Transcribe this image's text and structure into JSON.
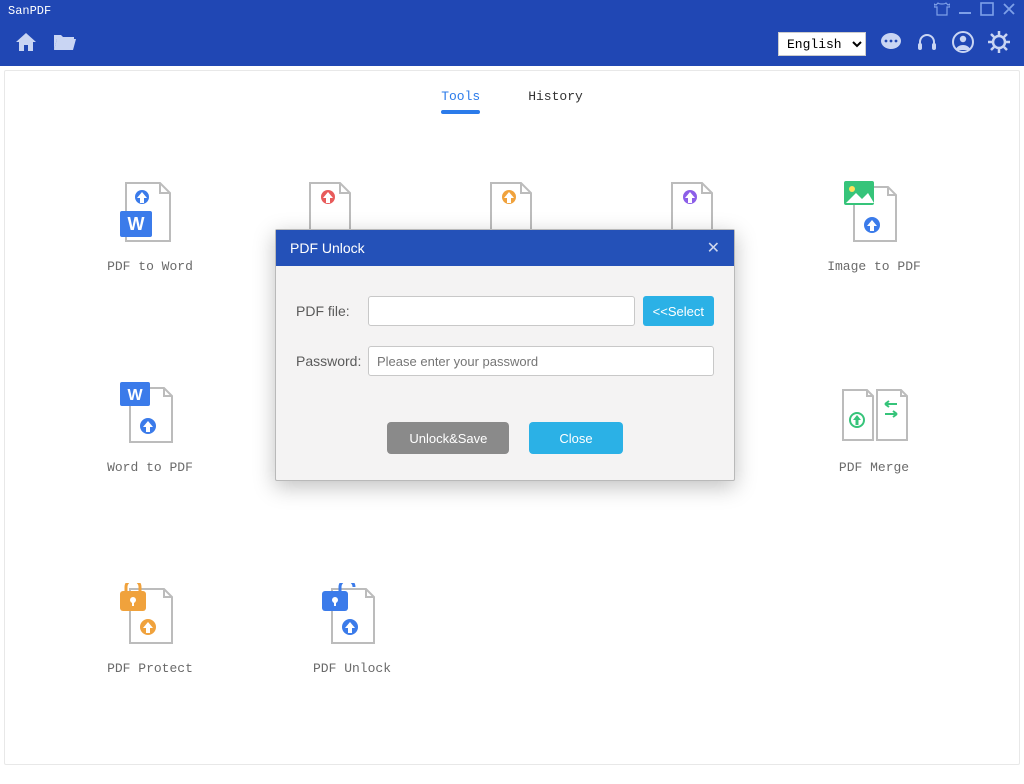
{
  "app": {
    "title": "SanPDF"
  },
  "toolbar": {
    "language": "English"
  },
  "tabs": {
    "tools": "Tools",
    "history": "History"
  },
  "tools": {
    "pdf_to_word": "PDF to Word",
    "image_to_pdf": "Image to PDF",
    "word_to_pdf": "Word to PDF",
    "pdf_merge": "PDF Merge",
    "pdf_protect": "PDF Protect",
    "pdf_unlock": "PDF Unlock"
  },
  "dialog": {
    "title": "PDF Unlock",
    "pdf_file_label": "PDF file:",
    "password_label": "Password:",
    "password_placeholder": "Please enter your password",
    "select_button": "<<Select",
    "unlock_button": "Unlock&Save",
    "close_button": "Close"
  }
}
